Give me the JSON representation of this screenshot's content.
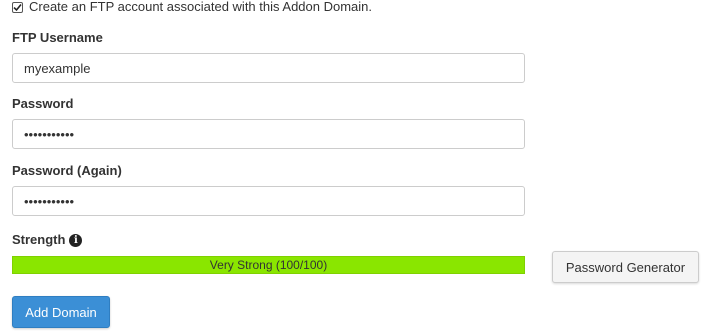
{
  "ftp_checkbox": {
    "checked": true,
    "label": "Create an FTP account associated with this Addon Domain."
  },
  "ftp_username": {
    "label": "FTP Username",
    "value": "myexample"
  },
  "password": {
    "label": "Password",
    "value": "•••••••••••"
  },
  "password_again": {
    "label": "Password (Again)",
    "value": "•••••••••••"
  },
  "strength": {
    "label": "Strength",
    "info_icon": "info-icon",
    "text": "Very Strong (100/100)",
    "level_percent": 100,
    "bar_color": "#8ae600"
  },
  "buttons": {
    "password_generator": "Password Generator",
    "add_domain": "Add Domain"
  }
}
